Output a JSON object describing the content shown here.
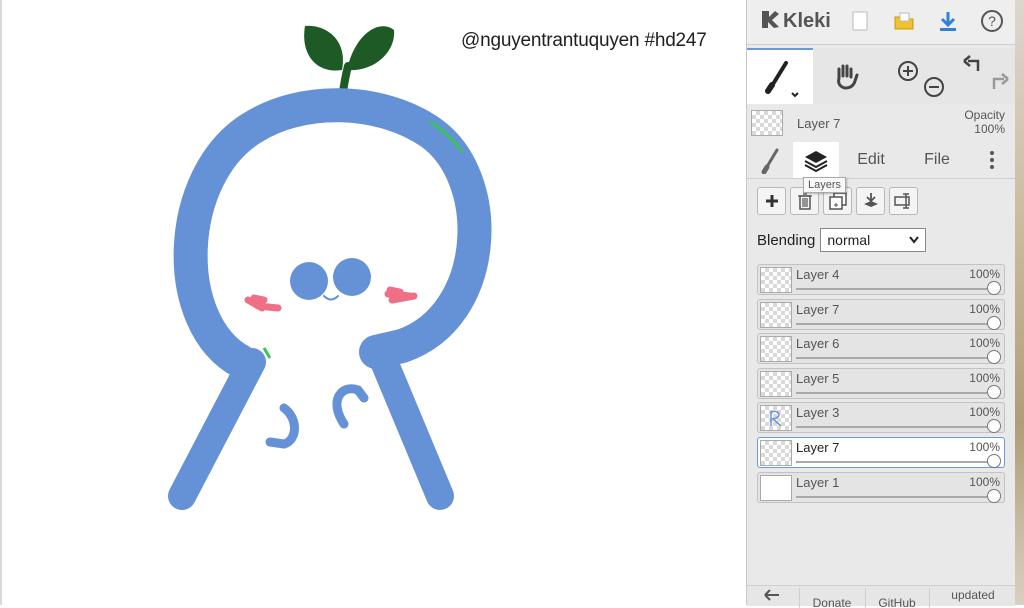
{
  "canvas": {
    "credit_text": "@nguyentrantuquyen #hd247"
  },
  "app": {
    "name": "Kleki"
  },
  "topbar": {
    "icons": [
      "kleki-logo-icon",
      "new-document-icon",
      "open-folder-icon",
      "download-icon",
      "help-icon"
    ]
  },
  "tools": {
    "items": [
      "brush-tool",
      "hand-tool",
      "zoom-in",
      "zoom-out",
      "undo",
      "redo"
    ],
    "active": "brush-tool"
  },
  "current_layer": {
    "name": "Layer 7",
    "opacity_label": "Opacity",
    "opacity_value": "100%"
  },
  "tabs": {
    "edit": "Edit",
    "file": "File",
    "active": "layers",
    "tooltip": "Layers"
  },
  "layer_buttons": [
    "add-layer",
    "delete-layer",
    "duplicate-layer",
    "merge-layer",
    "rename-layer"
  ],
  "blending": {
    "label": "Blending",
    "value": "normal"
  },
  "layers": [
    {
      "name": "Layer 4",
      "opacity": "100%",
      "selected": false
    },
    {
      "name": "Layer 7",
      "opacity": "100%",
      "selected": false
    },
    {
      "name": "Layer 6",
      "opacity": "100%",
      "selected": false
    },
    {
      "name": "Layer 5",
      "opacity": "100%",
      "selected": false
    },
    {
      "name": "Layer 3",
      "opacity": "100%",
      "selected": false
    },
    {
      "name": "Layer 7",
      "opacity": "100%",
      "selected": true
    },
    {
      "name": "Layer 1",
      "opacity": "100%",
      "selected": false
    }
  ],
  "bottombar": {
    "donate": "Donate",
    "github": "GitHub",
    "updated": "updated"
  },
  "colors": {
    "accent": "#6a9bd6",
    "character_blue": "#6592d6",
    "sprout_green": "#1e5a25",
    "blush_pink": "#ef6f85",
    "download_blue": "#2f80d8",
    "folder_yellow": "#f2c12e"
  }
}
